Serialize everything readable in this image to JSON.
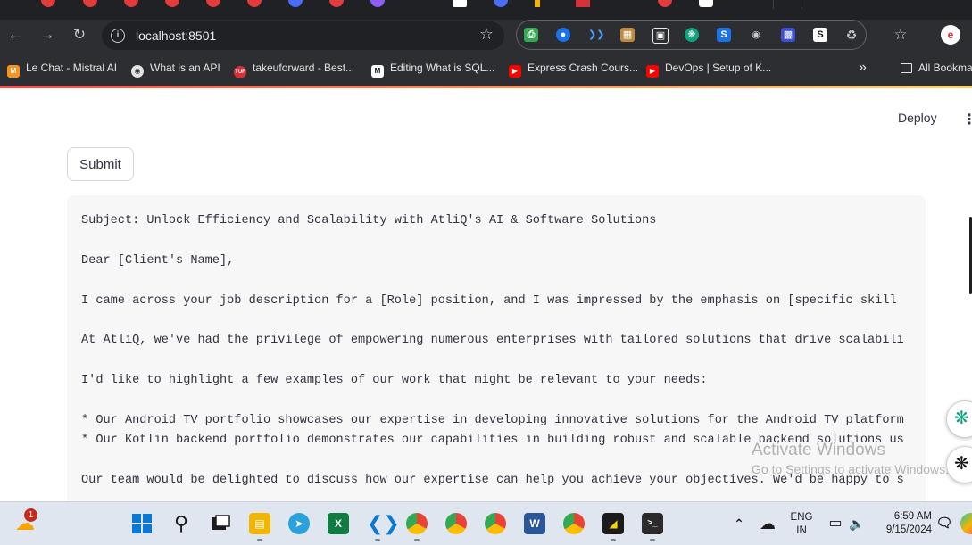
{
  "browser": {
    "url": "localhost:8501",
    "bookmarks": [
      {
        "label": "Le Chat - Mistral AI",
        "icon": "mistral-icon",
        "color": "#f7931e"
      },
      {
        "label": "What is an API",
        "icon": "api-icon",
        "color": "#6b6b6b"
      },
      {
        "label": "takeuforward - Best...",
        "icon": "tuf-icon",
        "color": "#d6323a"
      },
      {
        "label": "Editing What is SQL...",
        "icon": "medium-icon",
        "color": "#111111"
      },
      {
        "label": "Express Crash Cours...",
        "icon": "youtube-icon",
        "color": "#ff0000"
      },
      {
        "label": "DevOps | Setup of K...",
        "icon": "youtube-icon",
        "color": "#ff0000"
      }
    ],
    "bookmarks_more": "»",
    "all_bookmarks": "All Bookmarks"
  },
  "app": {
    "deploy_label": "Deploy",
    "menu_label": "⋮",
    "submit_label": "Submit",
    "email_lines": [
      "Subject: Unlock Efficiency and Scalability with AtliQ's AI & Software Solutions",
      "",
      "Dear [Client's Name],",
      "",
      "I came across your job description for a [Role] position, and I was impressed by the emphasis on [specific skill",
      "",
      "At AtliQ, we've had the privilege of empowering numerous enterprises with tailored solutions that drive scalabili",
      "",
      "I'd like to highlight a few examples of our work that might be relevant to your needs:",
      "",
      "* Our Android TV portfolio showcases our expertise in developing innovative solutions for the Android TV platform",
      "* Our Kotlin backend portfolio demonstrates our capabilities in building robust and scalable backend solutions us",
      "",
      "Our team would be delighted to discuss how our expertise can help you achieve your objectives. We'd be happy to s"
    ]
  },
  "watermark": {
    "line1": "Activate Windows",
    "line2": "Go to Settings to activate Windows."
  },
  "taskbar": {
    "weather_badge": "1",
    "language": "ENG",
    "region": "IN",
    "time": "6:59 AM",
    "date": "9/15/2024"
  },
  "colors": {
    "streamlit_accent": "#ff4b4b",
    "code_bg": "#f7f7f8",
    "text": "#31333f"
  }
}
